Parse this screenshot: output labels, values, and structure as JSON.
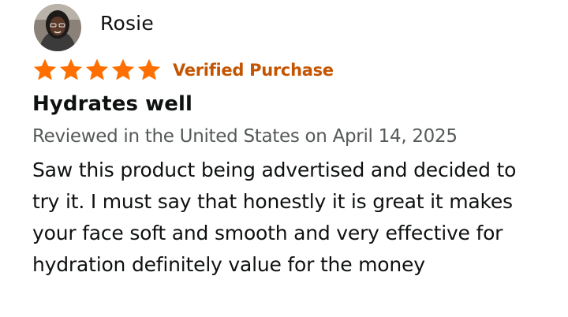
{
  "reviewer": {
    "name": "Rosie",
    "avatar_icon": "user-avatar"
  },
  "rating": {
    "stars": 5,
    "max": 5,
    "star_color": "#ff6f00",
    "badge": "Verified Purchase",
    "badge_color": "#c45500"
  },
  "review": {
    "title": "Hydrates well",
    "meta": "Reviewed in the United States on April 14, 2025",
    "body": "Saw this product being advertised and decided to try it. I must say that honestly it is great it makes your face soft and smooth and very effective for hydration definitely value for the money"
  }
}
